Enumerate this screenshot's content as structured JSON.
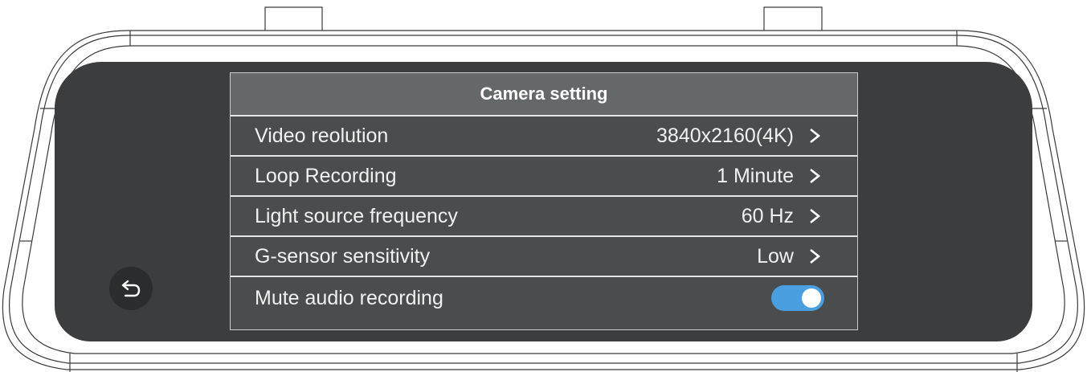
{
  "panel": {
    "title": "Camera setting",
    "rows": [
      {
        "label": "Video reolution",
        "value": "3840x2160(4K)"
      },
      {
        "label": "Loop Recording",
        "value": "1 Minute"
      },
      {
        "label": "Light source frequency",
        "value": "60 Hz"
      },
      {
        "label": "G-sensor sensitivity",
        "value": "Low"
      },
      {
        "label": "Mute audio recording",
        "toggle_on": true
      }
    ]
  },
  "icons": {
    "back": "back-arrow-icon",
    "chevron": "chevron-right-icon"
  },
  "colors": {
    "screen": "#3b3d3f",
    "header": "#656869",
    "row": "#4a4c4d",
    "toggle_accent": "#4a9fe0"
  }
}
